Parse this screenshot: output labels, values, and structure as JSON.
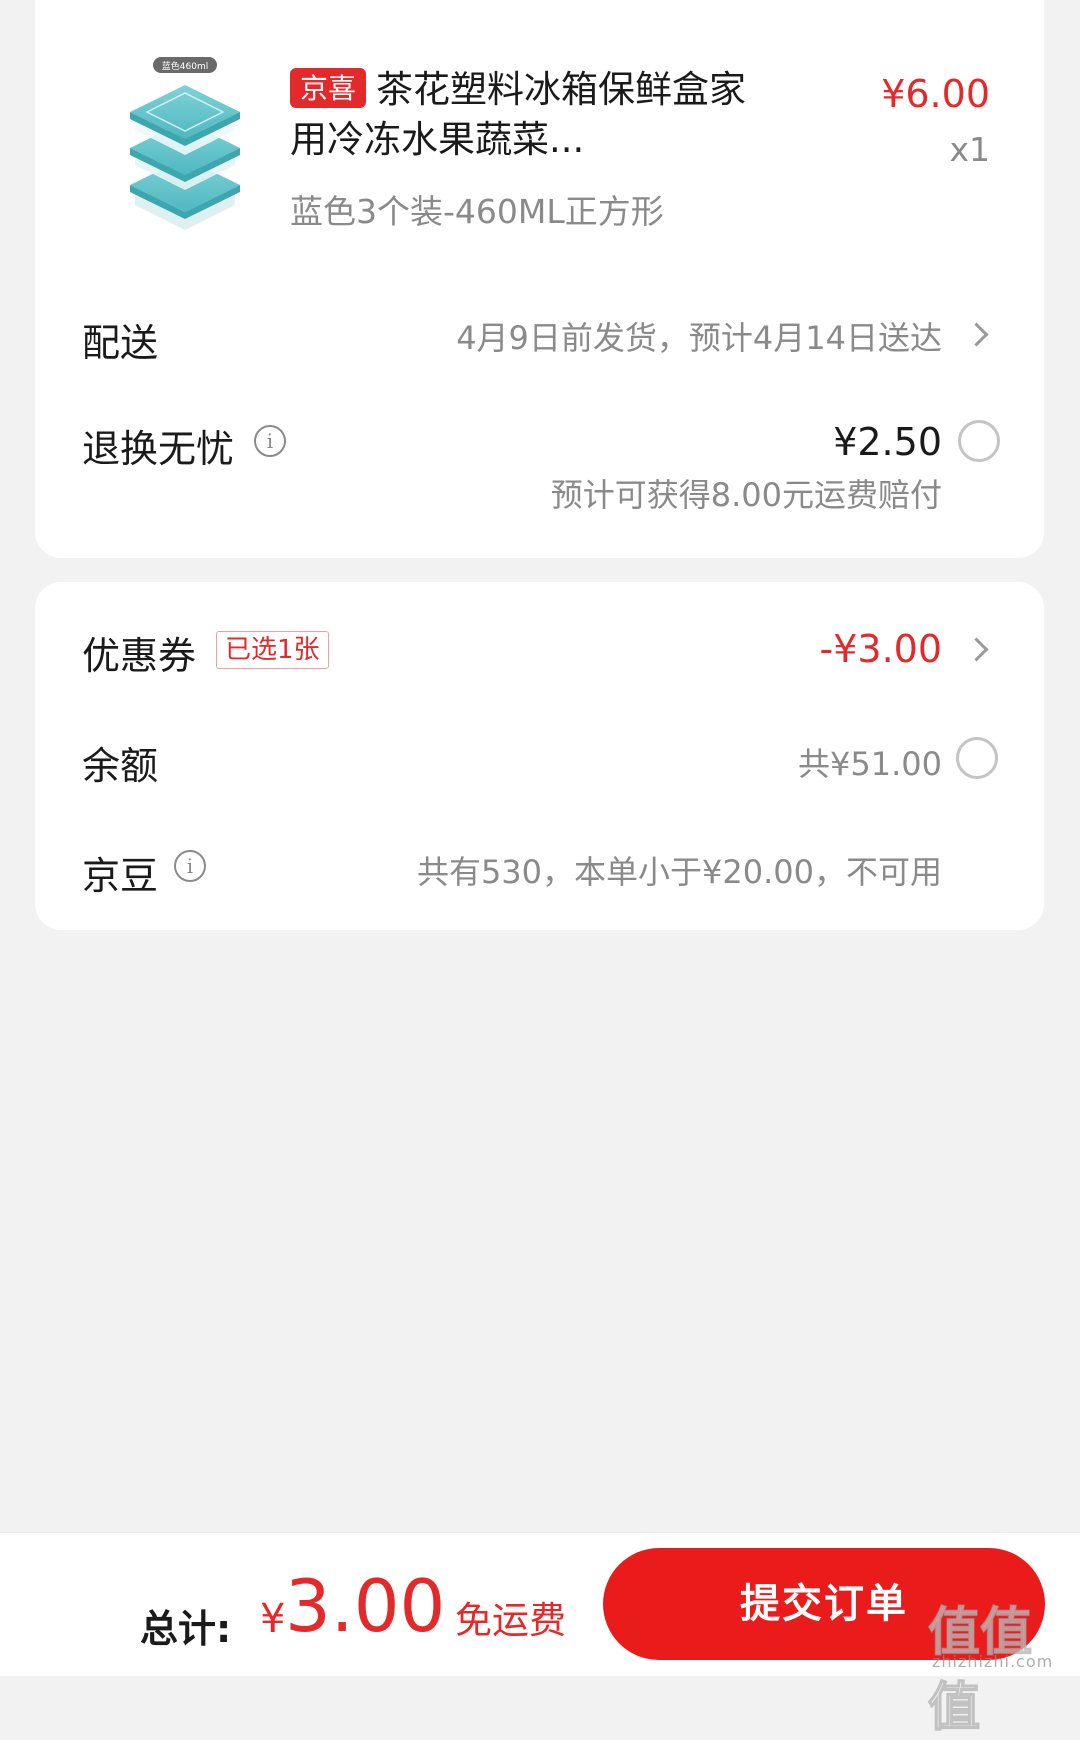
{
  "product": {
    "tag": "京喜",
    "title": "茶花塑料冰箱保鲜盒家用冷冻水果蔬菜...",
    "price": "¥6.00",
    "quantity": "x1",
    "spec": "蓝色3个装-460ML正方形",
    "image_label": "蓝色460ml"
  },
  "delivery": {
    "label": "配送",
    "value": "4月9日前发货，预计4月14日送达"
  },
  "return_insurance": {
    "label": "退换无忧",
    "price": "¥2.50",
    "note": "预计可获得8.00元运费赔付"
  },
  "coupon": {
    "label": "优惠券",
    "badge": "已选1张",
    "value": "-¥3.00"
  },
  "balance": {
    "label": "余额",
    "value": "共¥51.00"
  },
  "jingdou": {
    "label": "京豆",
    "value": "共有530，本单小于¥20.00，不可用"
  },
  "footer": {
    "total_label": "总计:",
    "currency": "¥",
    "total_amount": "3.00",
    "free_shipping": "免运费",
    "submit_label": "提交订单"
  },
  "watermark": {
    "text": "值值值",
    "site": "zhizhizhi.com"
  },
  "colors": {
    "accent_red": "#e4292a",
    "button_red": "#ea1b1b",
    "background": "#f2f2f2"
  }
}
